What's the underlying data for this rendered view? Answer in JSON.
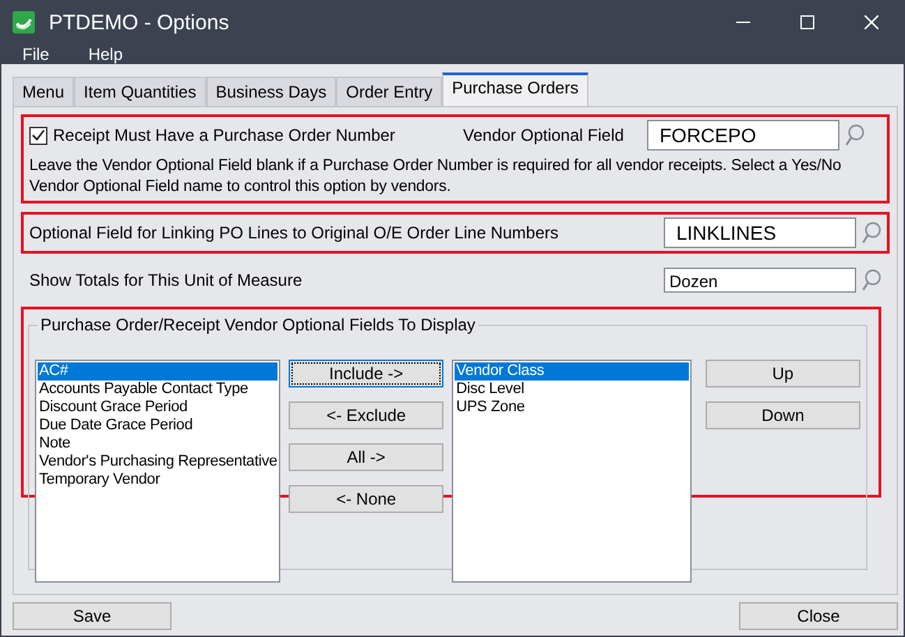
{
  "window": {
    "title": "PTDEMO - Options"
  },
  "menu": [
    {
      "label": "File"
    },
    {
      "label": "Help"
    }
  ],
  "tabs": [
    {
      "label": "Menu",
      "selected": false
    },
    {
      "label": "Item Quantities",
      "selected": false
    },
    {
      "label": "Business Days",
      "selected": false
    },
    {
      "label": "Order Entry",
      "selected": false
    },
    {
      "label": "Purchase Orders",
      "selected": true
    }
  ],
  "receipt_section": {
    "highlighted": true,
    "checkbox": {
      "label": "Receipt Must Have a Purchase Order Number",
      "checked": true
    },
    "field_label": "Vendor Optional Field",
    "field_value": "FORCEPO",
    "note": "Leave the Vendor Optional Field blank if a Purchase Order Number is required for all vendor receipts. Select a Yes/No Vendor Optional Field name to control this option by vendors."
  },
  "linking_section": {
    "highlighted": true,
    "label": "Optional Field for Linking PO Lines to Original O/E Order Line Numbers",
    "value": "LINKLINES"
  },
  "unit_row": {
    "label": "Show Totals for This Unit of Measure",
    "value": "Dozen"
  },
  "display_fields": {
    "highlighted": true,
    "title": "Purchase Order/Receipt Vendor Optional Fields To Display",
    "available": [
      {
        "label": "AC#",
        "selected": true
      },
      {
        "label": "Accounts Payable Contact Type",
        "selected": false
      },
      {
        "label": "Discount Grace Period",
        "selected": false
      },
      {
        "label": "Due Date Grace Period",
        "selected": false
      },
      {
        "label": "Note",
        "selected": false
      },
      {
        "label": "Vendor's Purchasing Representative",
        "selected": false
      },
      {
        "label": "Temporary Vendor",
        "selected": false
      }
    ],
    "move_buttons": [
      {
        "label": "Include ->",
        "focused": true
      },
      {
        "label": "<- Exclude",
        "focused": false
      },
      {
        "label": "All ->",
        "focused": false
      },
      {
        "label": "<- None",
        "focused": false
      }
    ],
    "included": [
      {
        "label": "Vendor Class",
        "selected": true
      },
      {
        "label": "Disc Level",
        "selected": false
      },
      {
        "label": "UPS Zone",
        "selected": false
      }
    ],
    "order_buttons": [
      {
        "label": "Up"
      },
      {
        "label": "Down"
      }
    ]
  },
  "footer_buttons": [
    {
      "label": "Save"
    },
    {
      "label": "Close"
    }
  ]
}
